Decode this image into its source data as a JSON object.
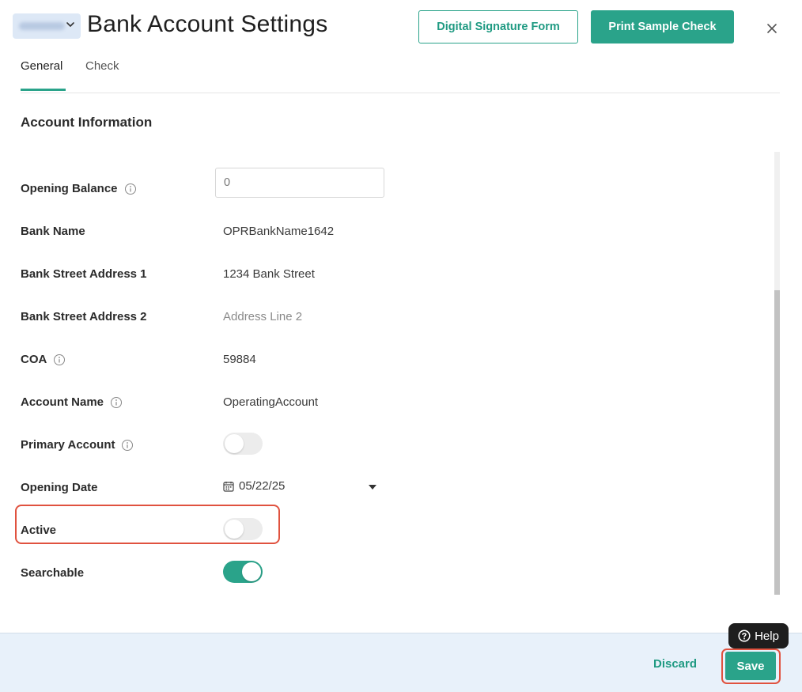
{
  "header": {
    "title": "Bank Account Settings",
    "digital_signature_label": "Digital Signature Form",
    "print_sample_label": "Print Sample Check"
  },
  "tabs": [
    {
      "label": "General",
      "active": true
    },
    {
      "label": "Check",
      "active": false
    }
  ],
  "section": {
    "title": "Account Information"
  },
  "fields": {
    "opening_balance": {
      "label": "Opening Balance",
      "placeholder": "0"
    },
    "bank_name": {
      "label": "Bank Name",
      "value": "OPRBankName1642"
    },
    "bank_street_1": {
      "label": "Bank Street Address 1",
      "value": "1234 Bank Street"
    },
    "bank_street_2": {
      "label": "Bank Street Address 2",
      "placeholder": "Address Line 2"
    },
    "coa": {
      "label": "COA",
      "value": "59884"
    },
    "account_name": {
      "label": "Account Name",
      "value": "OperatingAccount"
    },
    "primary_account": {
      "label": "Primary Account",
      "checked": false
    },
    "opening_date": {
      "label": "Opening Date",
      "value": "05/22/25"
    },
    "active": {
      "label": "Active",
      "checked": false
    },
    "searchable": {
      "label": "Searchable",
      "checked": true
    }
  },
  "footer": {
    "discard_label": "Discard",
    "save_label": "Save"
  },
  "help": {
    "label": "Help"
  },
  "colors": {
    "accent": "#2aa38a",
    "highlight": "#e0523f",
    "footer_bg": "#e8f1fa"
  }
}
